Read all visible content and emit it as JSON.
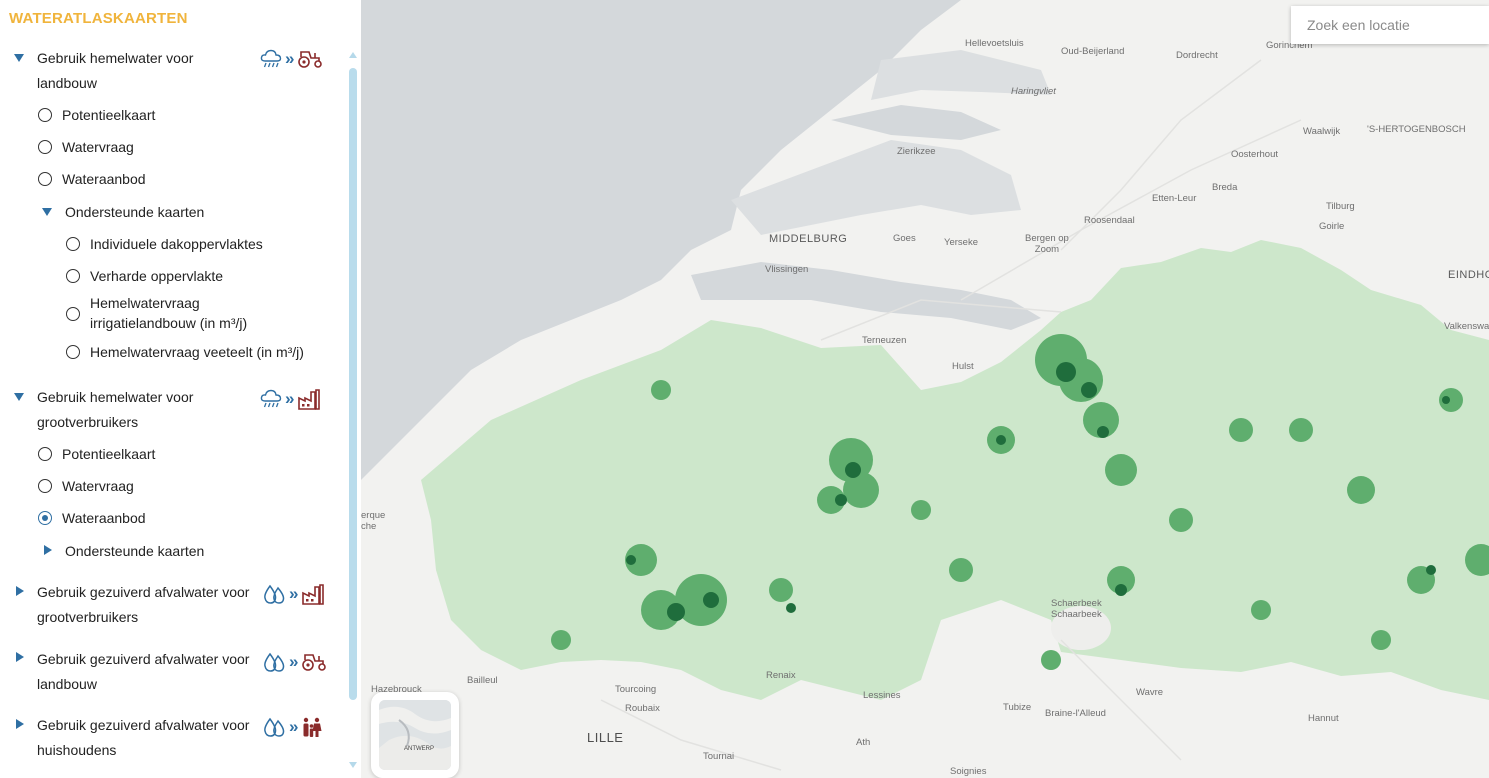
{
  "sidebar": {
    "title": "WATERATLASKAARTEN",
    "groups": [
      {
        "label_line1": "Gebruik hemelwater voor",
        "label_line2": "landbouw",
        "source_icon": "rain-cloud-icon",
        "target_icon": "tractor-icon",
        "items": [
          "Potentieelkaart",
          "Watervraag",
          "Wateraanbod"
        ],
        "support": {
          "label": "Ondersteunde kaarten",
          "items": [
            "Individuele dakoppervlaktes",
            "Verharde oppervlakte",
            "Hemelwatervraag",
            "irrigatielandbouw (in m³/j)",
            "Hemelwatervraag veeteelt (in m³/j)"
          ]
        }
      },
      {
        "label_line1": "Gebruik hemelwater voor",
        "label_line2": "grootverbruikers",
        "source_icon": "rain-cloud-icon",
        "target_icon": "factory-icon",
        "items": [
          "Potentieelkaart",
          "Watervraag",
          "Wateraanbod"
        ],
        "selected_item": "Wateraanbod",
        "support": {
          "label": "Ondersteunde kaarten"
        }
      },
      {
        "label_line1": "Gebruik gezuiverd afvalwater voor",
        "label_line2": "grootverbruikers",
        "source_icon": "water-drops-icon",
        "target_icon": "factory-icon"
      },
      {
        "label_line1": "Gebruik gezuiverd afvalwater voor",
        "label_line2": "landbouw",
        "source_icon": "water-drops-icon",
        "target_icon": "tractor-icon"
      },
      {
        "label_line1": "Gebruik gezuiverd afvalwater voor",
        "label_line2": "huishoudens",
        "source_icon": "water-drops-icon",
        "target_icon": "family-icon"
      }
    ],
    "chevron": "»"
  },
  "search": {
    "placeholder": "Zoek een locatie"
  },
  "map": {
    "places": {
      "hellevoetsluis": "Hellevoetsluis",
      "oud_beijerland": "Oud-Beijerland",
      "dordrecht": "Dordrecht",
      "gorinchem": "Gorinchem",
      "haringvliet": "Haringvliet",
      "waalwijk": "Waalwijk",
      "s_hertogenbosch": "'S-HERTOGENBOSCH",
      "zierikzee": "Zierikzee",
      "oosterhout": "Oosterhout",
      "breda": "Breda",
      "etten_leur": "Etten-Leur",
      "roosendaal": "Roosendaal",
      "tilburg": "Tilburg",
      "goirle": "Goirle",
      "middelburg": "MIDDELBURG",
      "goes": "Goes",
      "yerseke": "Yerseke",
      "bergen_op_zoom_1": "Bergen op",
      "bergen_op_zoom_2": "Zoom",
      "vlissingen": "Vlissingen",
      "eindhoven": "EINDHO",
      "valkenswaard": "Valkenswa",
      "terneuzen": "Terneuzen",
      "hulst": "Hulst",
      "erquel_1": "erque",
      "erquel_2": "che",
      "schaerbeek_1": "Schaerbeek",
      "schaerbeek_2": "Schaarbeek",
      "bailleul": "Bailleul",
      "tourcoing": "Tourcoing",
      "roubaix": "Roubaix",
      "lessines": "Lessines",
      "wavre": "Wavre",
      "tubize": "Tubize",
      "braine": "Braine-l'Alleud",
      "hannut": "Hannut",
      "lille": "LILLE",
      "ath": "Ath",
      "tournai": "Tournai",
      "soignies": "Soignies",
      "hazebrouck": "Hazebrouck",
      "ronse": "Renaix"
    },
    "colors": {
      "sea": "#d4d8db",
      "land": "#f2f2f0",
      "flanders_base": "#cde7cb",
      "dense_green": "#1f6d3c",
      "mid_green": "#5fae6e"
    }
  },
  "minimap": {
    "label": "ANTWERP"
  }
}
